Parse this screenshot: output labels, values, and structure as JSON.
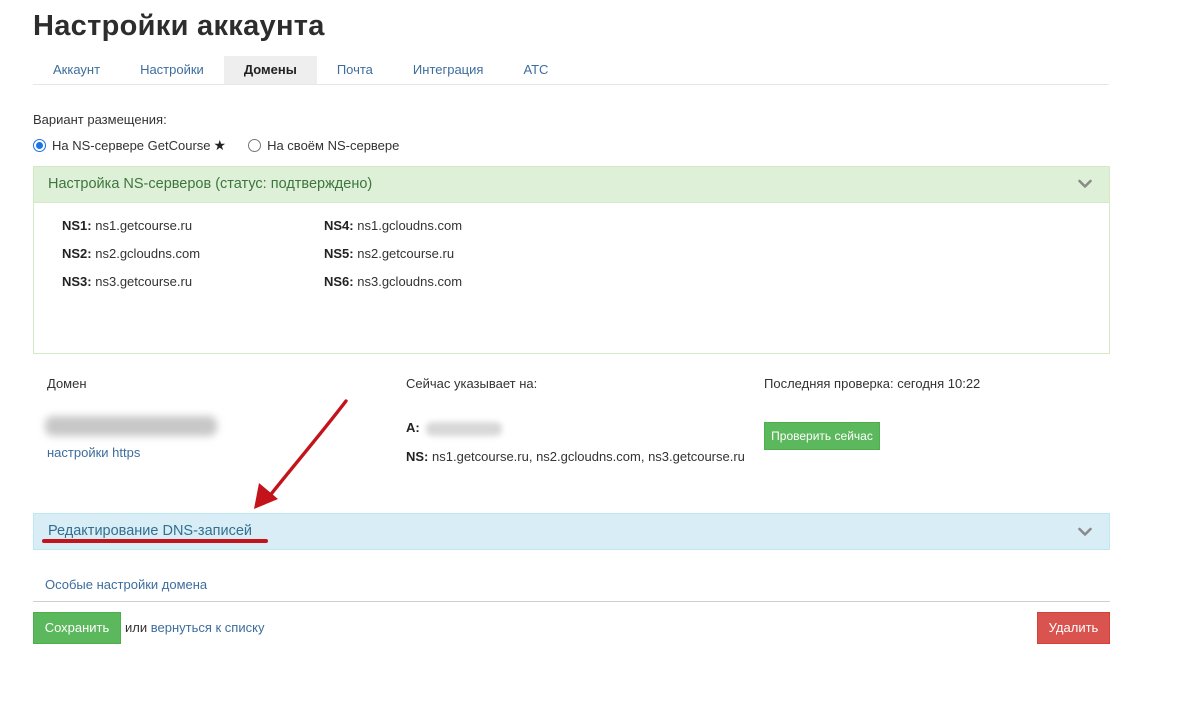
{
  "page_title": "Настройки аккаунта",
  "tabs": [
    {
      "label": "Аккаунт",
      "active": false
    },
    {
      "label": "Настройки",
      "active": false
    },
    {
      "label": "Домены",
      "active": true
    },
    {
      "label": "Почта",
      "active": false
    },
    {
      "label": "Интеграция",
      "active": false
    },
    {
      "label": "АТС",
      "active": false
    }
  ],
  "placement": {
    "label": "Вариант размещения:",
    "options": [
      {
        "label": "На NS-сервере GetCourse",
        "checked": true,
        "star": "★"
      },
      {
        "label": "На своём NS-сервере",
        "checked": false
      }
    ]
  },
  "ns_panel": {
    "title": "Настройка NS-серверов (статус: подтверждено)",
    "servers": [
      {
        "key": "NS1:",
        "value": "ns1.getcourse.ru"
      },
      {
        "key": "NS2:",
        "value": "ns2.gcloudns.com"
      },
      {
        "key": "NS3:",
        "value": "ns3.getcourse.ru"
      },
      {
        "key": "NS4:",
        "value": "ns1.gcloudns.com"
      },
      {
        "key": "NS5:",
        "value": "ns2.getcourse.ru"
      },
      {
        "key": "NS6:",
        "value": "ns3.gcloudns.com"
      }
    ]
  },
  "domain_section": {
    "col_domain": "Домен",
    "col_points_to": "Сейчас указывает на:",
    "col_last_check": "Последняя проверка: сегодня 10:22",
    "https_link": "настройки https",
    "record_a_key": "A:",
    "record_ns_key": "NS:",
    "record_ns_value": "ns1.getcourse.ru, ns2.gcloudns.com, ns3.getcourse.ru",
    "check_button": "Проверить сейчас"
  },
  "dns_panel": {
    "title": "Редактирование DNS-записей"
  },
  "special_settings_link": "Особые настройки домена",
  "footer": {
    "save_button": "Сохранить",
    "or_text": "или",
    "back_link": "вернуться к списку",
    "delete_button": "Удалить"
  },
  "colors": {
    "success": "#5cb85c",
    "danger": "#d9534f",
    "link": "#3d6d9e",
    "annotation": "#c3141c"
  }
}
